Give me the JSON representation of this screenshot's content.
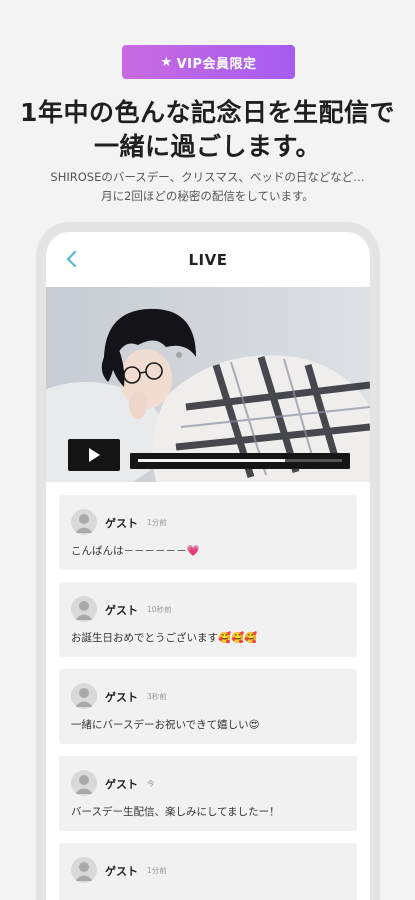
{
  "badge": {
    "star_icon": "★",
    "label": "VIP会員限定",
    "color_start": "#c86be0",
    "color_end": "#a65cf0"
  },
  "headline": {
    "line1": "1年中の色んな記念日を生配信で",
    "line2": "一緒に過ごします。"
  },
  "subtext": {
    "line1": "SHIROSEのバースデー、クリスマス、ベッドの日などなど…",
    "line2": "月に2回ほどの秘密の配信をしています。"
  },
  "app": {
    "title": "LIVE",
    "back_icon": "chevron-left-icon",
    "accent": "#5bb7d6"
  },
  "video": {
    "play_icon": "play-icon",
    "progress": 0.72
  },
  "comments": [
    {
      "name": "ゲスト",
      "time": "1分前",
      "text": "こんばんは－－－－－－💗"
    },
    {
      "name": "ゲスト",
      "time": "10秒前",
      "text": "お誕生日おめでとうございます🥰🥰🥰"
    },
    {
      "name": "ゲスト",
      "time": "3秒前",
      "text": "一緒にバースデーお祝いできて嬉しい😍"
    },
    {
      "name": "ゲスト",
      "time": "今",
      "text": "バースデー生配信、楽しみにしてましたー！"
    },
    {
      "name": "ゲスト",
      "time": "1分前",
      "text": ""
    }
  ]
}
